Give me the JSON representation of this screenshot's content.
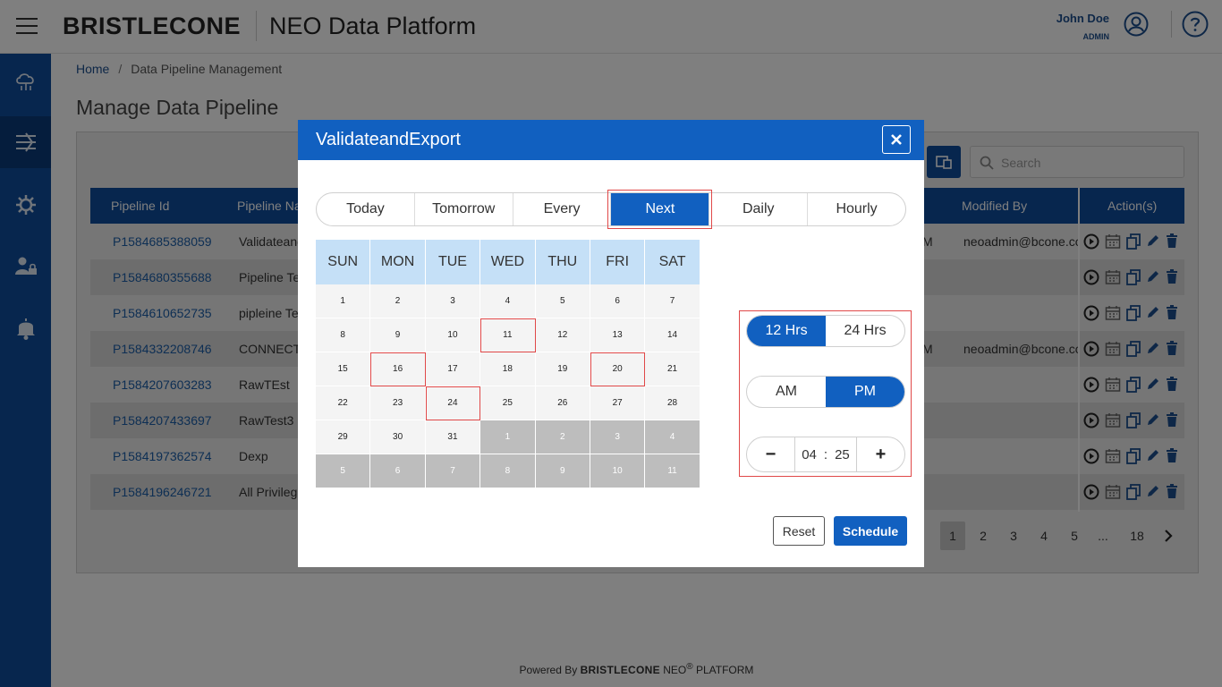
{
  "header": {
    "brand": "BRISTLECONE",
    "app_title": "NEO Data Platform",
    "user_name": "John Doe",
    "user_role": "ADMIN"
  },
  "breadcrumb": {
    "home": "Home",
    "current": "Data Pipeline Management"
  },
  "page_title": "Manage Data Pipeline",
  "search": {
    "placeholder": "Search"
  },
  "table": {
    "columns": {
      "id": "Pipeline Id",
      "name": "Pipeline Na",
      "modified_by": "Modified By",
      "actions": "Action(s)"
    },
    "rows": [
      {
        "id": "P1584685388059",
        "name": "Validateand",
        "suffix": "M",
        "modified_by": "neoadmin@bcone.co"
      },
      {
        "id": "P1584680355688",
        "name": "Pipeline Te",
        "suffix": "",
        "modified_by": ""
      },
      {
        "id": "P1584610652735",
        "name": "pipleine Te",
        "suffix": "",
        "modified_by": ""
      },
      {
        "id": "P1584332208746",
        "name": "CONNECTI",
        "suffix": "M",
        "modified_by": "neoadmin@bcone.co"
      },
      {
        "id": "P1584207603283",
        "name": "RawTEst",
        "suffix": "",
        "modified_by": ""
      },
      {
        "id": "P1584207433697",
        "name": "RawTest3",
        "suffix": "",
        "modified_by": ""
      },
      {
        "id": "P1584197362574",
        "name": "Dexp",
        "suffix": "",
        "modified_by": ""
      },
      {
        "id": "P1584196246721",
        "name": "All Privileg",
        "suffix": "",
        "modified_by": ""
      }
    ]
  },
  "pagination": {
    "pages": [
      "1",
      "2",
      "3",
      "4",
      "5",
      "...",
      "18"
    ],
    "current": "1"
  },
  "footer": {
    "powered_by": "Powered By",
    "brand": "BRISTLECONE",
    "neo": "NEO",
    "reg": "®",
    "platform": "PLATFORM"
  },
  "modal": {
    "title": "ValidateandExport",
    "tabs": [
      "Today",
      "Tomorrow",
      "Every",
      "Next",
      "Daily",
      "Hourly"
    ],
    "selected_tab": "Next",
    "weekdays": [
      "SUN",
      "MON",
      "TUE",
      "WED",
      "THU",
      "FRI",
      "SAT"
    ],
    "days": [
      "1",
      "2",
      "3",
      "4",
      "5",
      "6",
      "7",
      "8",
      "9",
      "10",
      "11",
      "12",
      "13",
      "14",
      "15",
      "16",
      "17",
      "18",
      "19",
      "20",
      "21",
      "22",
      "23",
      "24",
      "25",
      "26",
      "27",
      "28",
      "29",
      "30",
      "31",
      "1",
      "2",
      "3",
      "4",
      "5",
      "6",
      "7",
      "8",
      "9",
      "10",
      "11"
    ],
    "marked_days": [
      "11",
      "16",
      "20",
      "24"
    ],
    "time": {
      "format_12": "12 Hrs",
      "format_24": "24 Hrs",
      "format_selected": "12 Hrs",
      "am": "AM",
      "pm": "PM",
      "period_selected": "PM",
      "hour": "04",
      "separator": ":",
      "minute": "25",
      "minus": "−",
      "plus": "+"
    },
    "reset_label": "Reset",
    "schedule_label": "Schedule"
  },
  "colors": {
    "brand_blue": "#0e4c9d",
    "modal_blue": "#1160c0",
    "highlight": "#e04848"
  }
}
